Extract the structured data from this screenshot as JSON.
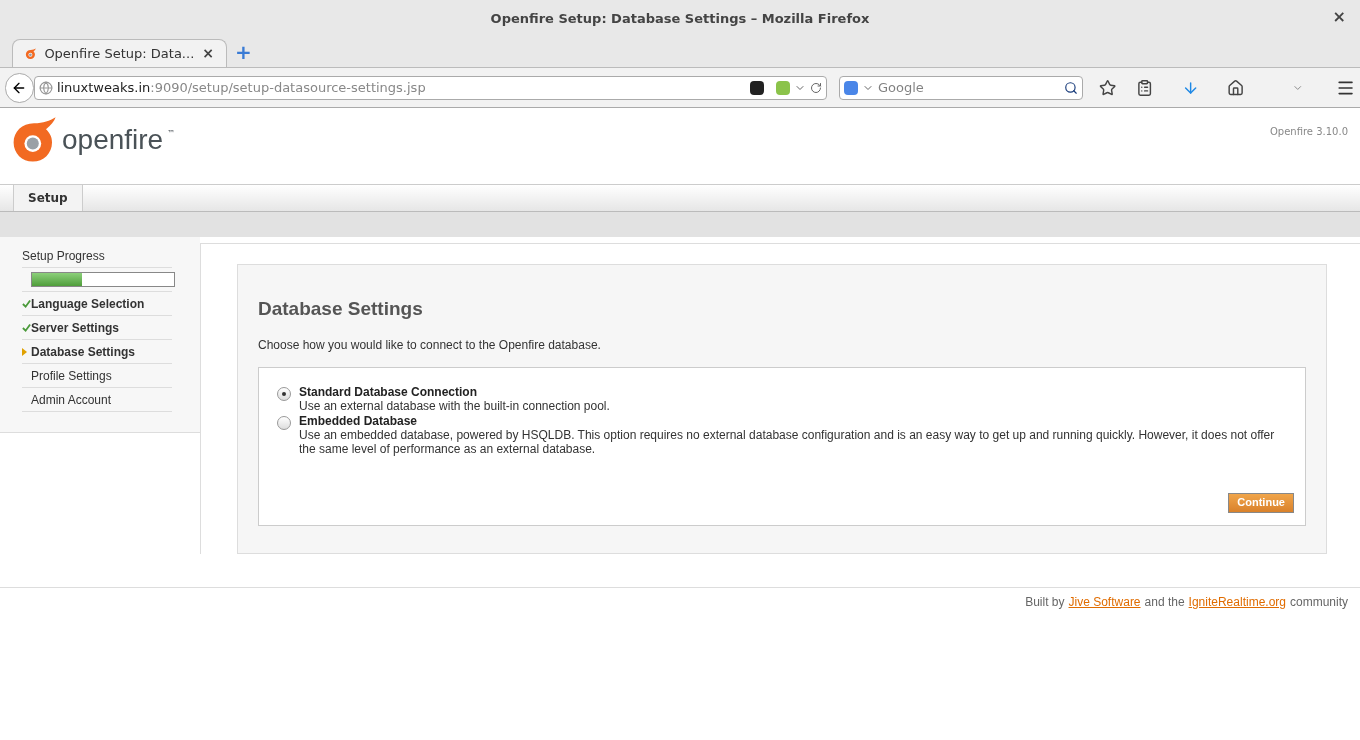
{
  "browser": {
    "title": "Openfire Setup: Database Settings – Mozilla Firefox",
    "close": "×",
    "tabs": [
      {
        "title": "Openfire Setup: Data...",
        "close": "×",
        "selected": true
      }
    ],
    "new_tab": "+",
    "url": {
      "host": "linuxtweaks.in",
      "path": ":9090/setup/setup-datasource-settings.jsp"
    },
    "search": {
      "placeholder": "Google"
    }
  },
  "header": {
    "logo": "openfire",
    "logo_mark": "™",
    "version": "Openfire 3.10.0"
  },
  "nav_tabs": [
    {
      "label": "Setup",
      "selected": true
    }
  ],
  "sidebar": {
    "title": "Setup Progress",
    "progress": {
      "level": 0.35
    },
    "steps": [
      {
        "label": "Language Selection",
        "completed": true,
        "current": false
      },
      {
        "label": "Server Settings",
        "completed": true,
        "current": false
      },
      {
        "label": "Database Settings",
        "completed": false,
        "current": true
      },
      {
        "label": "Profile Settings",
        "completed": false,
        "current": false
      },
      {
        "label": "Admin Account",
        "completed": false,
        "current": false
      }
    ]
  },
  "main": {
    "title": "Database Settings",
    "intro": "Choose how you would like to connect to the Openfire database.",
    "options": [
      {
        "title": "Standard Database Connection",
        "description": "Use an external database with the built-in connection pool.",
        "selected": true
      },
      {
        "title": "Embedded Database",
        "description": "Use an embedded database, powered by HSQLDB. This option requires no external database configuration and is an easy way to get up and running quickly. However, it does not offer the same level of performance as an external database.",
        "selected": false
      }
    ],
    "button": "Continue"
  },
  "footer": [
    {
      "kind": "text",
      "text": "Built by"
    },
    {
      "kind": "link",
      "text": "Jive Software"
    },
    {
      "kind": "text",
      "text": "and the"
    },
    {
      "kind": "link",
      "text": "IgniteRealtime.org"
    },
    {
      "kind": "text",
      "text": "community"
    }
  ]
}
